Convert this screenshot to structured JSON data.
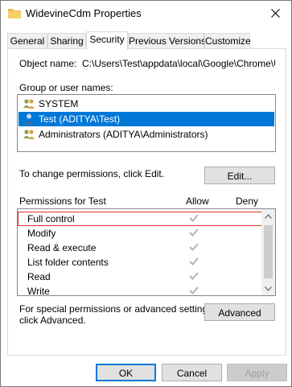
{
  "window": {
    "title": "WidevineCdm Properties"
  },
  "tabs": [
    {
      "label": "General"
    },
    {
      "label": "Sharing"
    },
    {
      "label": "Security"
    },
    {
      "label": "Previous Versions"
    },
    {
      "label": "Customize"
    }
  ],
  "object": {
    "label": "Object name:",
    "value": "C:\\Users\\Test\\appdata\\local\\Google\\Chrome\\User"
  },
  "groups": {
    "label": "Group or user names:",
    "items": [
      {
        "label": "SYSTEM",
        "selected": false
      },
      {
        "label": "Test (ADITYA\\Test)",
        "selected": true
      },
      {
        "label": "Administrators (ADITYA\\Administrators)",
        "selected": false
      }
    ]
  },
  "change_perm": {
    "text": "To change permissions, click Edit.",
    "button": "Edit..."
  },
  "permissions": {
    "header": "Permissions for Test",
    "allow": "Allow",
    "deny": "Deny",
    "rows": [
      {
        "label": "Full control",
        "allow": true,
        "highlighted": true
      },
      {
        "label": "Modify",
        "allow": true
      },
      {
        "label": "Read & execute",
        "allow": true
      },
      {
        "label": "List folder contents",
        "allow": true
      },
      {
        "label": "Read",
        "allow": true
      },
      {
        "label": "Write",
        "allow": true
      }
    ]
  },
  "advanced": {
    "line1": "For special permissions or advanced settings,",
    "line2": "click Advanced.",
    "button": "Advanced"
  },
  "footer": {
    "ok": "OK",
    "cancel": "Cancel",
    "apply": "Apply"
  },
  "colors": {
    "selection": "#0078d7",
    "highlight_border": "#d9342b",
    "check": "#b4b4b4"
  }
}
